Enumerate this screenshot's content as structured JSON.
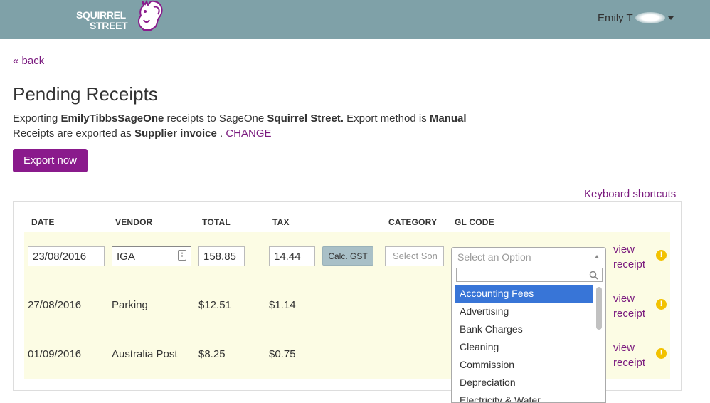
{
  "header": {
    "logo_line1": "SQUIRREL",
    "logo_line2": "STREET",
    "user_name": "Emily T"
  },
  "nav": {
    "back_label": "« back"
  },
  "page": {
    "title": "Pending Receipts",
    "line1_prefix": "Exporting ",
    "account": "EmilyTibbsSageOne",
    "line1_mid": " receipts to SageOne ",
    "org": "Squirrel Street.",
    "line1_method_label": " Export method is ",
    "method": "Manual",
    "line2_prefix": "Receipts are exported as ",
    "export_type": "Supplier invoice",
    "line2_sep": " . ",
    "change_label": "CHANGE",
    "export_button": "Export now",
    "keyboard_shortcuts": "Keyboard shortcuts"
  },
  "table": {
    "headers": {
      "date": "DATE",
      "vendor": "VENDOR",
      "total": "TOTAL",
      "tax": "TAX",
      "category": "CATEGORY",
      "gl_code": "GL CODE"
    },
    "edit_row": {
      "date": "23/08/2016",
      "vendor": "IGA",
      "total": "158.85",
      "tax": "14.44",
      "calc_button": "Calc. GST",
      "category_placeholder": "Select Son",
      "gl_placeholder": "Select an Option",
      "view_line1": "view",
      "view_line2": "receipt"
    },
    "rows": [
      {
        "date": "27/08/2016",
        "vendor": "Parking",
        "total": "$12.51",
        "tax": "$1.14",
        "view_line1": "view",
        "view_line2": "receipt"
      },
      {
        "date": "01/09/2016",
        "vendor": "Australia Post",
        "total": "$8.25",
        "tax": "$0.75",
        "view_line1": "view",
        "view_line2": "receipt"
      }
    ]
  },
  "gl_dropdown": {
    "search_value": "",
    "options": [
      "Accounting Fees",
      "Advertising",
      "Bank Charges",
      "Cleaning",
      "Commission",
      "Depreciation",
      "Electricity & Water"
    ],
    "highlighted": "Accounting Fees"
  },
  "icons": {
    "warning": "warning-icon",
    "search": "search-icon",
    "contact_card": "contact-card-icon",
    "logo_squirrel": "squirrel-logo-icon"
  },
  "colors": {
    "topbar": "#7fa1a8",
    "brand_purple": "#8a1a8c",
    "link_purple": "#7a1a7e",
    "row_highlight": "#fcfce4",
    "select_highlight": "#3875d7",
    "warning": "#f2c200"
  }
}
